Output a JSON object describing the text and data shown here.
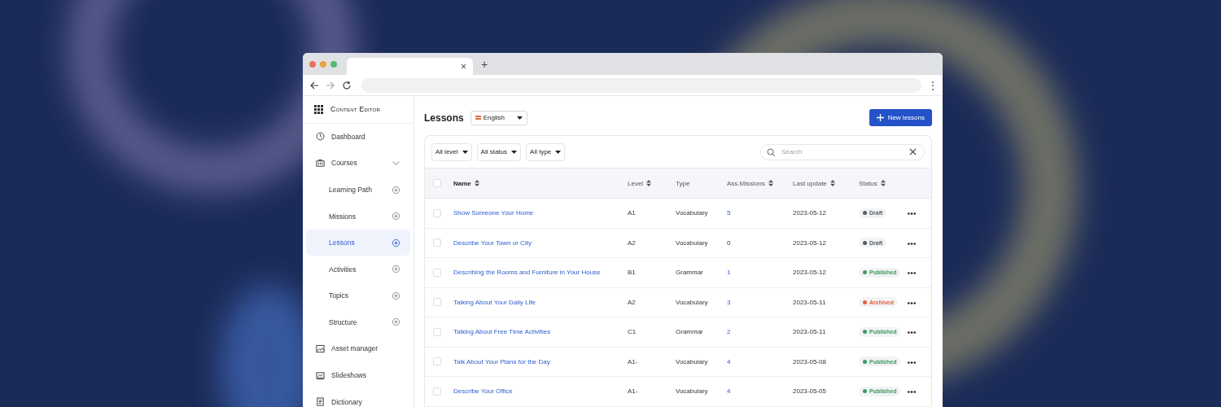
{
  "browser": {
    "tab_close": "×",
    "new_tab": "+",
    "menu": "⋮"
  },
  "sidebar": {
    "title": "Content Editor",
    "items": [
      {
        "label": "Dashboard",
        "selected": false
      },
      {
        "label": "Courses",
        "selected": false,
        "expanded": true,
        "children": [
          {
            "label": "Learning Path",
            "selected": false
          },
          {
            "label": "Missions",
            "selected": false
          },
          {
            "label": "Lessons",
            "selected": true
          },
          {
            "label": "Activities",
            "selected": false
          },
          {
            "label": "Topics",
            "selected": false
          },
          {
            "label": "Structure",
            "selected": false
          }
        ]
      },
      {
        "label": "Asset manager",
        "selected": false
      },
      {
        "label": "Slideshows",
        "selected": false
      },
      {
        "label": "Dictionary",
        "selected": false
      }
    ]
  },
  "page": {
    "title": "Lessons",
    "language": "English",
    "new_button": "New lessons"
  },
  "filters": [
    "All level",
    "All status",
    "All type"
  ],
  "search": {
    "placeholder": "Search"
  },
  "table": {
    "all_checked": false,
    "columns": [
      {
        "label": "Name",
        "sortable": true
      },
      {
        "label": "Level",
        "sortable": true
      },
      {
        "label": "Type",
        "sortable": false
      },
      {
        "label": "Ass.Missions",
        "sortable": true
      },
      {
        "label": "Last update",
        "sortable": true
      },
      {
        "label": "Status",
        "sortable": true
      }
    ],
    "rows": [
      {
        "checked": false,
        "name": "Show Someone Your Home",
        "level": "A1",
        "type": "Vocabulary",
        "missions": "5",
        "missions_link": true,
        "updated": "2023-05-12",
        "status": "Draft",
        "color": "#555b66"
      },
      {
        "checked": false,
        "name": "Describe Your Town or City",
        "level": "A2",
        "type": "Vocabulary",
        "missions": "0",
        "missions_link": false,
        "updated": "2023-05-12",
        "status": "Draft",
        "color": "#555b66"
      },
      {
        "checked": false,
        "name": "Describing the Rooms and Furniture in Your House",
        "level": "B1",
        "type": "Grammar",
        "missions": "1",
        "missions_link": true,
        "updated": "2023-05-12",
        "status": "Published",
        "color": "#3a9a5c"
      },
      {
        "checked": false,
        "name": "Talking About Your Daily Life",
        "level": "A2",
        "type": "Vocabulary",
        "missions": "3",
        "missions_link": true,
        "updated": "2023-05-11",
        "status": "Archived",
        "color": "#e0613a"
      },
      {
        "checked": false,
        "name": "Talking About Free Time Activities",
        "level": "C1",
        "type": "Grammar",
        "missions": "2",
        "missions_link": true,
        "updated": "2023-05-11",
        "status": "Published",
        "color": "#3a9a5c"
      },
      {
        "checked": false,
        "name": "Talk About Your Plans for the Day",
        "level": "A1-",
        "type": "Vocabulary",
        "missions": "4",
        "missions_link": true,
        "updated": "2023-05-08",
        "status": "Published",
        "color": "#3a9a5c"
      },
      {
        "checked": false,
        "name": "Describe Your Office",
        "level": "A1-",
        "type": "Vocabulary",
        "missions": "4",
        "missions_link": true,
        "updated": "2023-05-05",
        "status": "Published",
        "color": "#3a9a5c"
      }
    ]
  }
}
